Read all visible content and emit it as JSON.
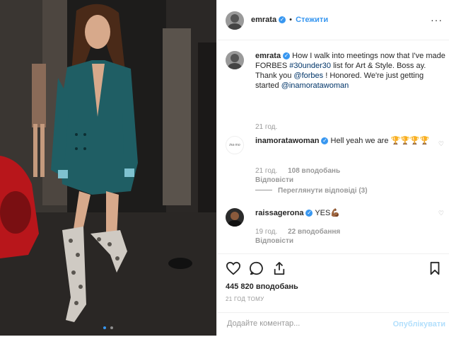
{
  "post": {
    "author": "emrata",
    "follow_label": "Стежити",
    "bullet": "•",
    "photo_alt": "Woman in teal blazer and snakeskin boots walking at night"
  },
  "caption": {
    "author": "emrata",
    "text_1": "How I walk into meetings now that I've made FORBES ",
    "hashtag": "#30under30",
    "text_2": " list for Art & Style. Boss ay. Thank you ",
    "mention_1": "@forbes",
    "text_3": " ! Honored. We're just getting started ",
    "mention_2": "@inamoratawoman",
    "time": "21 год."
  },
  "comments": [
    {
      "author": "inamoratawoman",
      "text": "Hell yeah we are 🏆🏆🏆🏆",
      "time": "21 год.",
      "likes": "108 вподобань",
      "reply": "Відповісти",
      "view_replies": "Переглянути відповіді (3)"
    },
    {
      "author": "raissagerona",
      "text": "YES💪🏾",
      "time": "19 год.",
      "likes": "22 вподобання",
      "reply": "Відповісти"
    }
  ],
  "actions": {
    "likes_count": "445 820 вподобань",
    "timestamp": "21 ГОД ТОМУ"
  },
  "composer": {
    "placeholder": "Додайте коментар...",
    "post_label": "Опублікувати"
  },
  "colors": {
    "accent": "#3897f0",
    "link": "#003569",
    "muted": "#999999"
  }
}
